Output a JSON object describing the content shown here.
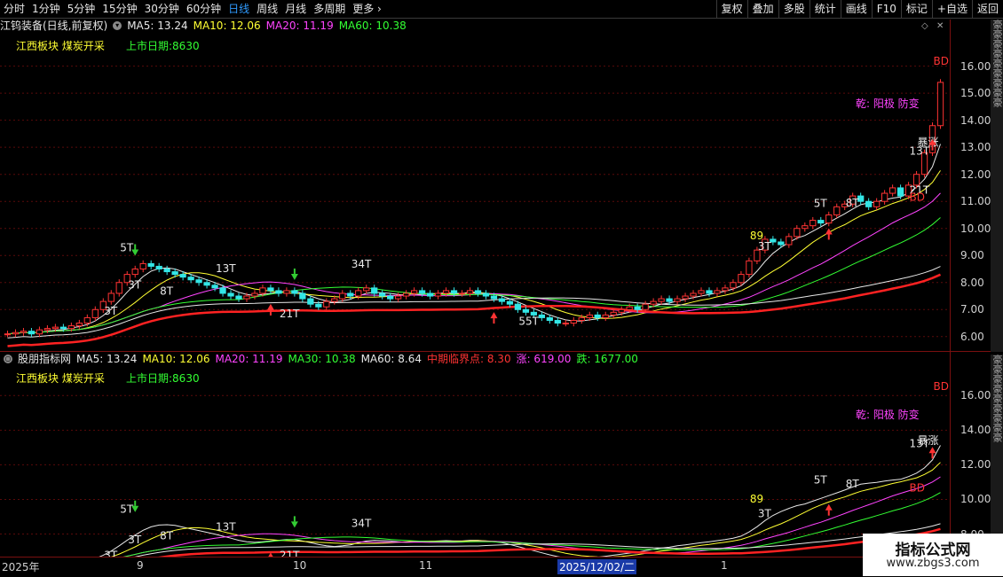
{
  "toolbar": {
    "periods": [
      "分时",
      "1分钟",
      "5分钟",
      "15分钟",
      "30分钟",
      "60分钟",
      "日线",
      "周线",
      "月线",
      "多周期",
      "更多"
    ],
    "active_period": "日线",
    "right_buttons": [
      "复权",
      "叠加",
      "多股",
      "统计",
      "画线",
      "F10",
      "标记",
      "+自选",
      "返回"
    ]
  },
  "main": {
    "title": "江钨装备(日线,前复权)",
    "ma": [
      {
        "label": "MA5: 13.24",
        "color": "#e8e8e8"
      },
      {
        "label": "MA10: 12.06",
        "color": "#ffff33"
      },
      {
        "label": "MA20: 11.19",
        "color": "#ff44ff"
      },
      {
        "label": "MA60: 10.38",
        "color": "#33ff33"
      }
    ],
    "sector": "江西板块  煤炭开采",
    "listing": "上市日期:8630",
    "signal": "乾: 阳极 防变",
    "y_ticks": [
      "16.00",
      "15.00",
      "14.00",
      "13.00",
      "12.00",
      "11.00",
      "10.00",
      "9.00",
      "8.00",
      "7.00",
      "6.00"
    ]
  },
  "sub": {
    "title": "股朋指标网",
    "ma": [
      {
        "label": "MA5: 13.24",
        "color": "#e8e8e8"
      },
      {
        "label": "MA10: 12.06",
        "color": "#ffff33"
      },
      {
        "label": "MA20: 11.19",
        "color": "#ff44ff"
      },
      {
        "label": "MA30: 10.38",
        "color": "#33ff33"
      },
      {
        "label": "MA60: 8.64",
        "color": "#e8e8e8"
      },
      {
        "label": "中期临界点: 8.30",
        "color": "#ff3333"
      },
      {
        "label": "涨: 619.00",
        "color": "#ff44ff"
      },
      {
        "label": "跌: 1677.00",
        "color": "#33ff33"
      }
    ],
    "sector": "江西板块  煤炭开采",
    "listing": "上市日期:8630",
    "signal": "乾: 阳极 防变",
    "y_ticks": [
      "16.00",
      "14.00",
      "12.00",
      "10.00",
      "8.00"
    ]
  },
  "annotations": {
    "main": [
      "5T",
      "3T",
      "3T",
      "8T",
      "13T",
      "21T",
      "34T",
      "55T",
      "89",
      "3T",
      "5T",
      "8T",
      "13T",
      "21T",
      "暴涨",
      "BD",
      "BD"
    ],
    "sub": [
      "5T",
      "3T",
      "3T",
      "8T",
      "13T",
      "21T",
      "34T",
      "55T",
      "89",
      "3T",
      "5T",
      "8T",
      "13T",
      "暴涨",
      "BD",
      "BD"
    ]
  },
  "date_axis": {
    "labels": [
      "2025年",
      "9",
      "10",
      "11",
      "2025/12/02/二",
      "1"
    ],
    "selected": "2025/12/02/二"
  },
  "right_strip": "豪豪豪豪豪豪豪豪豪",
  "watermark": {
    "line1": "指标公式网",
    "line2": "www.zbgs3.com"
  },
  "chart_data": {
    "type": "candlestick",
    "ylim_main": [
      5.6,
      17.2
    ],
    "ylim_sub": [
      6.8,
      17.6
    ],
    "closes": [
      6.1,
      6.15,
      6.2,
      6.1,
      6.25,
      6.3,
      6.35,
      6.3,
      6.4,
      6.5,
      6.7,
      7.0,
      7.3,
      7.6,
      8.0,
      8.3,
      8.5,
      8.7,
      8.6,
      8.5,
      8.4,
      8.3,
      8.2,
      8.1,
      8.0,
      7.9,
      7.8,
      7.6,
      7.5,
      7.4,
      7.5,
      7.6,
      7.8,
      7.7,
      7.6,
      7.7,
      7.6,
      7.4,
      7.2,
      7.1,
      7.3,
      7.4,
      7.6,
      7.5,
      7.7,
      7.8,
      7.6,
      7.5,
      7.4,
      7.5,
      7.6,
      7.7,
      7.6,
      7.5,
      7.6,
      7.7,
      7.6,
      7.6,
      7.7,
      7.6,
      7.5,
      7.4,
      7.3,
      7.2,
      7.0,
      6.9,
      6.8,
      6.7,
      6.6,
      6.5,
      6.5,
      6.6,
      6.7,
      6.8,
      6.7,
      6.8,
      6.9,
      7.0,
      7.1,
      7.0,
      7.2,
      7.3,
      7.4,
      7.3,
      7.4,
      7.5,
      7.6,
      7.7,
      7.6,
      7.7,
      7.8,
      8.0,
      8.3,
      8.8,
      9.2,
      9.6,
      9.5,
      9.4,
      9.7,
      10.0,
      10.1,
      10.3,
      10.2,
      10.5,
      10.8,
      10.9,
      11.2,
      11.0,
      10.8,
      11.0,
      11.3,
      11.5,
      11.2,
      11.6,
      12.0,
      12.8,
      13.8,
      15.4
    ]
  }
}
